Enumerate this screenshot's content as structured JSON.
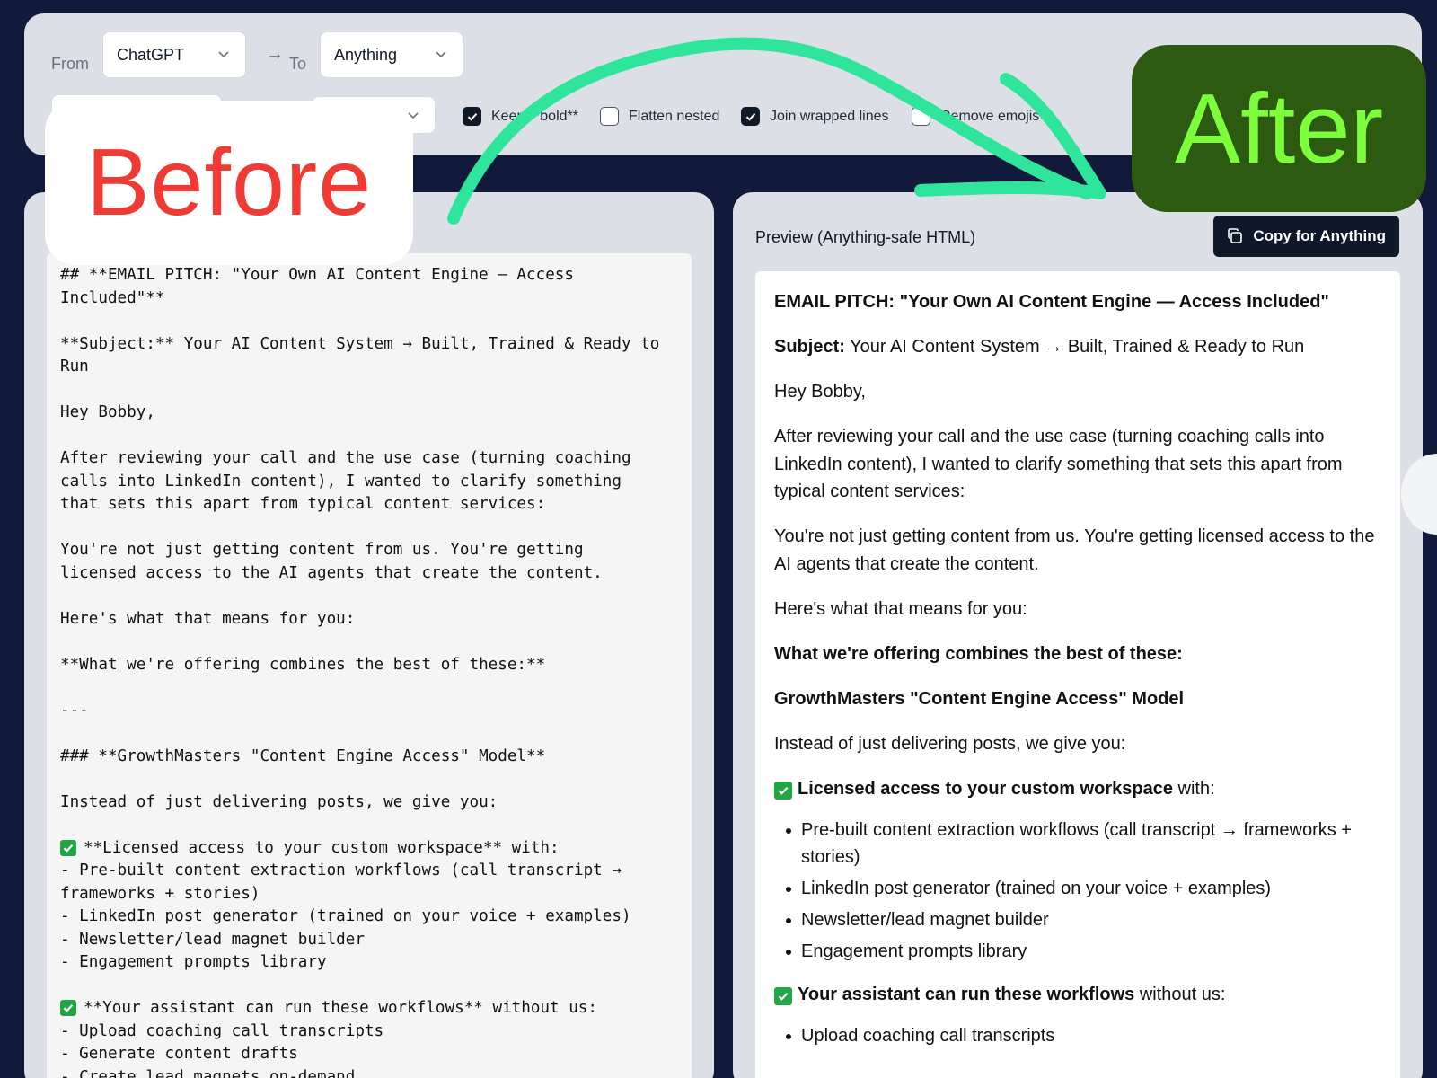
{
  "toolbar": {
    "from_label": "From",
    "from_value": "ChatGPT",
    "to_label": "To",
    "to_value": "Anything",
    "options": [
      {
        "label": "Keep **bold**",
        "checked": true
      },
      {
        "label": "Flatten nested",
        "checked": false
      },
      {
        "label": "Join wrapped lines",
        "checked": true
      },
      {
        "label": "Remove emojis",
        "checked": false
      }
    ]
  },
  "overlay": {
    "before": "Before",
    "after": "After"
  },
  "source": {
    "lines": [
      "## **EMAIL PITCH: \"Your Own AI Content Engine — Access",
      "Included\"**",
      "",
      "**Subject:** Your AI Content System → Built, Trained & Ready to",
      "Run",
      "",
      "Hey Bobby,",
      "",
      "After reviewing your call and the use case (turning coaching",
      "calls into LinkedIn content), I wanted to clarify something",
      "that sets this apart from typical content services:",
      "",
      "You're not just getting content from us. You're getting",
      "licensed access to the AI agents that create the content.",
      "",
      "Here's what that means for you:",
      "",
      "**What we're offering combines the best of these:**",
      "",
      "---",
      "",
      "### **GrowthMasters \"Content Engine Access\" Model**",
      "",
      "Instead of just delivering posts, we give you:",
      "",
      "**Licensed access to your custom workspace** with:",
      "- Pre-built content extraction workflows (call transcript →",
      "frameworks + stories)",
      "- LinkedIn post generator (trained on your voice + examples)",
      "- Newsletter/lead magnet builder",
      "- Engagement prompts library",
      "",
      "**Your assistant can run these workflows** without us:",
      "- Upload coaching call transcripts",
      "- Generate content drafts",
      "- Create lead magnets on-demand"
    ]
  },
  "preview": {
    "title": "Preview (Anything-safe HTML)",
    "copy_button": "Copy for Anything",
    "heading": "EMAIL PITCH: \"Your Own AI Content Engine — Access Included\"",
    "subject_label": "Subject:",
    "subject_text": " Your AI Content System → Built, Trained & Ready to Run",
    "greeting": "Hey Bobby,",
    "para1": "After reviewing your call and the use case (turning coaching calls into LinkedIn content), I wanted to clarify something that sets this apart from typical content services:",
    "para2": "You're not just getting content from us. You're getting licensed access to the AI agents that create the content.",
    "para3": "Here's what that means for you:",
    "offering": "What we're offering combines the best of these:",
    "model": "GrowthMasters \"Content Engine Access\" Model",
    "intro": "Instead of just delivering posts, we give you:",
    "item1_bold": "Licensed access to your custom workspace",
    "item1_rest": " with:",
    "list1": [
      "Pre-built content extraction workflows (call transcript → frameworks + stories)",
      "LinkedIn post generator (trained on your voice + examples)",
      "Newsletter/lead magnet builder",
      "Engagement prompts library"
    ],
    "item2_bold": "Your assistant can run these workflows",
    "item2_rest": " without us:",
    "list2": [
      "Upload coaching call transcripts"
    ]
  },
  "colors": {
    "background": "#111a3a",
    "before_text": "#ef3b34",
    "after_bg": "#2d5a11",
    "after_text": "#7cff3a",
    "arrow": "#2ee59b",
    "check": "#21a645"
  }
}
